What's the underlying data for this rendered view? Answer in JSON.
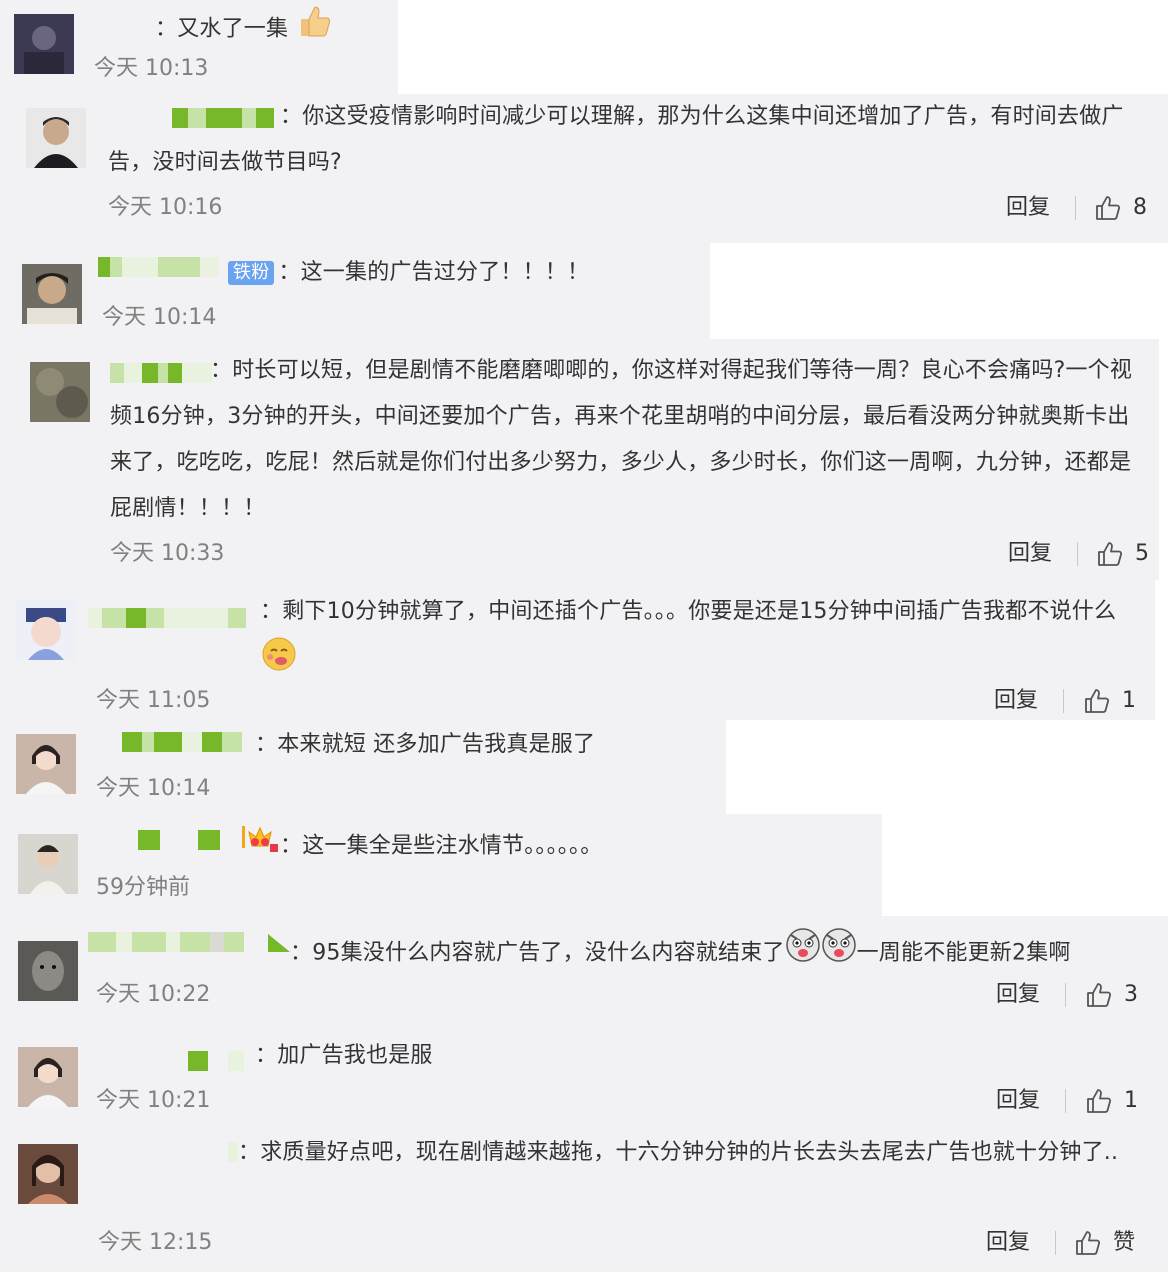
{
  "comments": [
    {
      "colon": "：",
      "text": "又水了一集",
      "time": "今天 10:13"
    },
    {
      "colon": "：",
      "text": "你这受疫情影响时间减少可以理解，那为什么这集中间还增加了广告，有时间去做广告，没时间去做节目吗?",
      "time": "今天 10:16",
      "reply": "回复",
      "likes": "8"
    },
    {
      "badge": "铁粉",
      "colon": "：",
      "text": "这一集的广告过分了！！！！",
      "time": "今天 10:14"
    },
    {
      "colon": "：",
      "text": "时长可以短，但是剧情不能磨磨唧唧的，你这样对得起我们等待一周？良心不会痛吗?一个视频16分钟，3分钟的开头，中间还要加个广告，再来个花里胡哨的中间分层，最后看没两分钟就奥斯卡出来了，吃吃吃，吃屁！然后就是你们付出多少努力，多少人，多少时长，你们这一周啊，九分钟，还都是屁剧情！！！！",
      "time": "今天 10:33",
      "reply": "回复",
      "likes": "5"
    },
    {
      "colon": "：",
      "text": "剩下10分钟就算了，中间还插个广告。。。你要是还是15分钟中间插广告我都不说什么",
      "time": "今天 11:05",
      "reply": "回复",
      "likes": "1"
    },
    {
      "colon": "：",
      "text": "本来就短 还多加广告我真是服了",
      "time": "今天 10:14"
    },
    {
      "colon": "：",
      "text": "这一集全是些注水情节。。。。。。",
      "time": "59分钟前"
    },
    {
      "colon": "：",
      "text": "95集没什么内容就广告了，没什么内容就结束了",
      "text2": "一周能不能更新2集啊",
      "time": "今天 10:22",
      "reply": "回复",
      "likes": "3"
    },
    {
      "colon": "：",
      "text": "加广告我也是服",
      "time": "今天 10:21",
      "reply": "回复",
      "likes": "1"
    },
    {
      "colon": "：",
      "text": "求质量好点吧，现在剧情越来越拖，十六分钟分钟的片长去头去尾去广告也就十分钟了..",
      "time": "今天 12:15",
      "reply": "回复",
      "likes": "赞"
    }
  ],
  "icons": {
    "like": "thumbs-up-icon",
    "thumb_emoji": "thumbs-up-emoji",
    "drool_emoji": "drooling-face-emoji",
    "husky_emoji": "husky-emoji",
    "crown": "crown-badge-icon"
  },
  "colors": {
    "card_bg": "#f2f2f5",
    "time": "#808080",
    "badge": "#6aa3ef",
    "mosaic": "#76b82a"
  }
}
